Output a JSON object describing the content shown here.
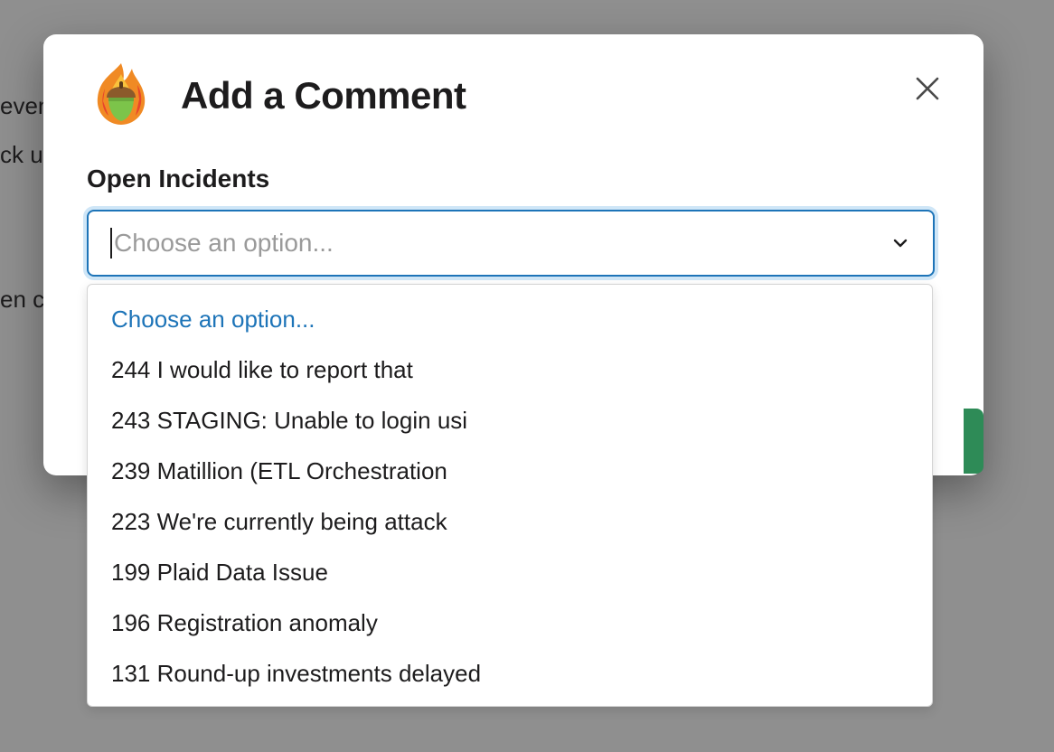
{
  "background": {
    "fragments": [
      "even",
      "ck u",
      "en c"
    ]
  },
  "modal": {
    "title": "Add a Comment",
    "logo_icon": "flame-acorn-logo",
    "close_icon": "close-icon"
  },
  "field": {
    "label": "Open Incidents",
    "placeholder": "Choose an option..."
  },
  "dropdown": {
    "options": [
      "Choose an option...",
      "244 I would like to report that",
      "243 STAGING: Unable to login usi",
      "239 Matillion (ETL Orchestration",
      "223 We're currently being attack",
      "199 Plaid Data Issue",
      "196 Registration anomaly",
      "131 Round-up investments delayed"
    ]
  },
  "colors": {
    "accent": "#1d74b8",
    "submit": "#2e8b57"
  }
}
